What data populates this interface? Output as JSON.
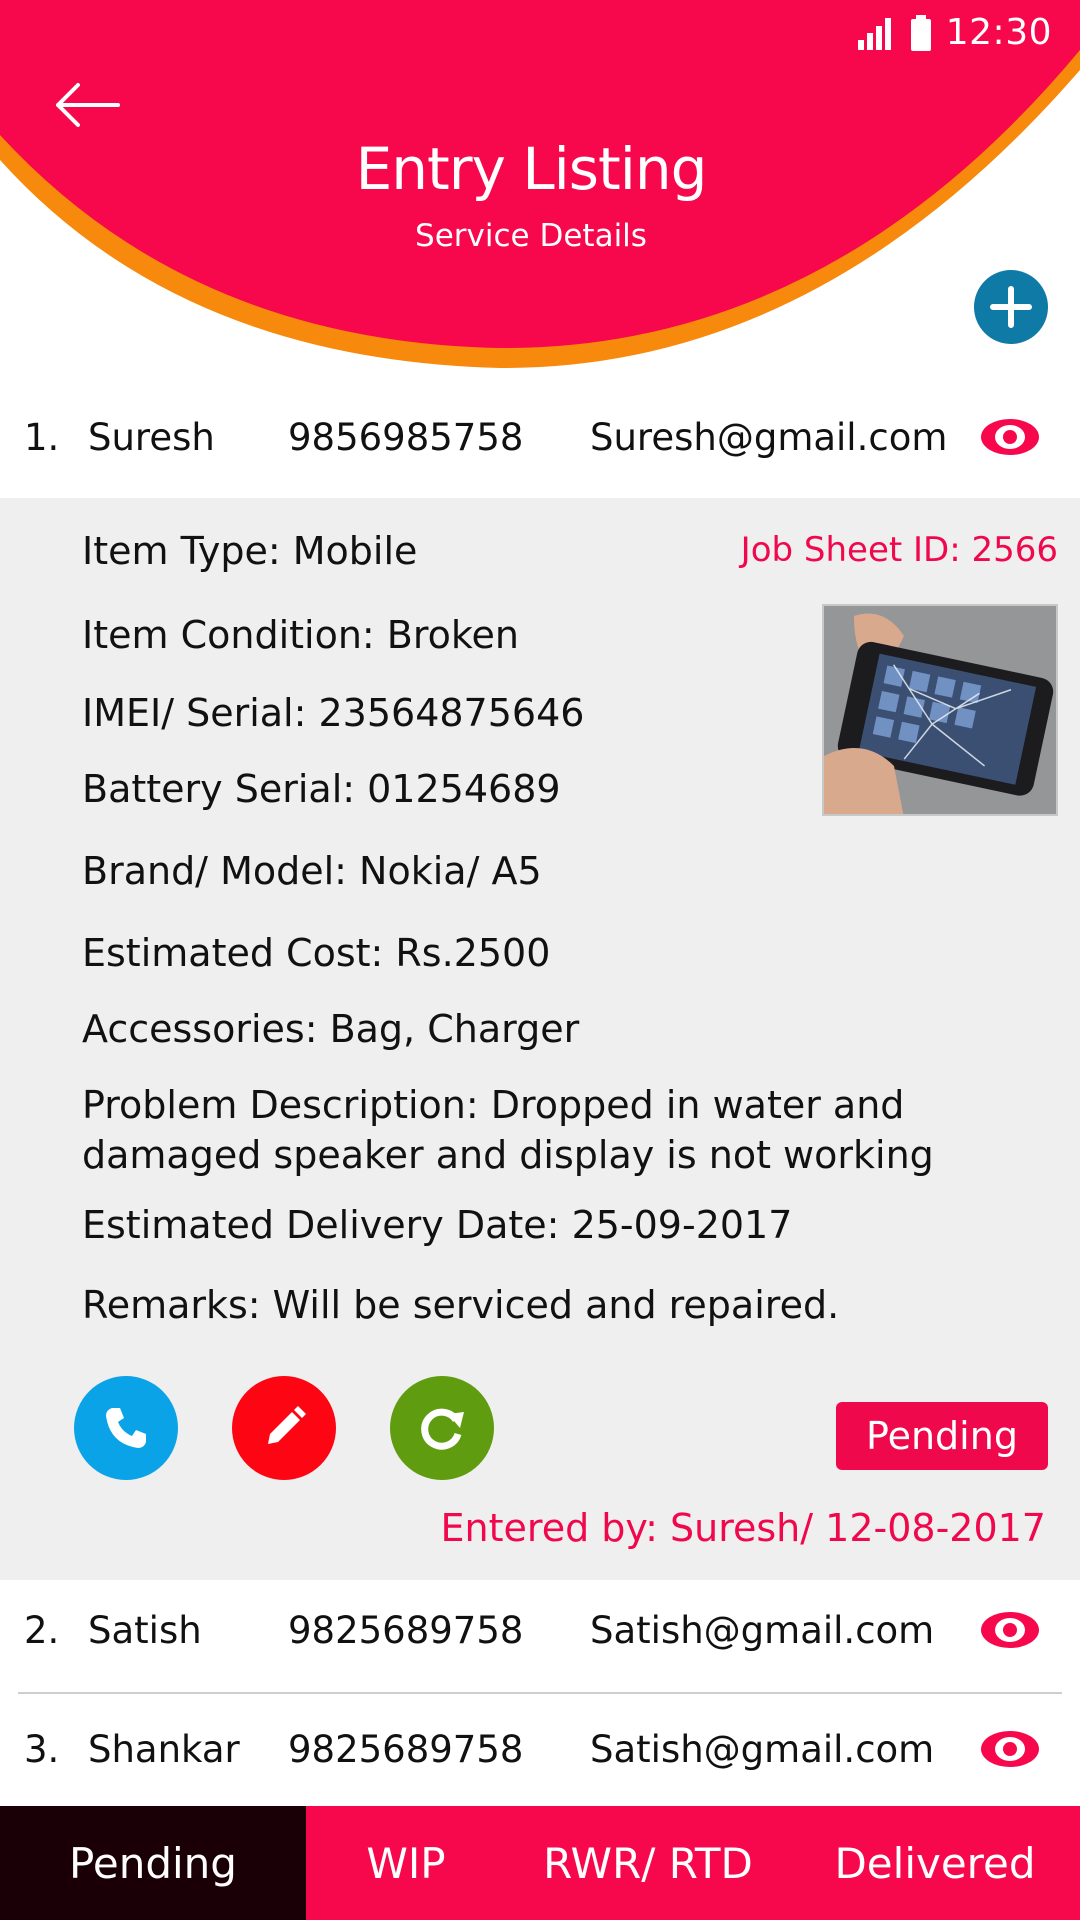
{
  "status_bar": {
    "time": "12:30"
  },
  "header": {
    "title": "Entry Listing",
    "subtitle": "Service Details",
    "primary_color": "#f7074b",
    "accent_color": "#f7890c"
  },
  "entries": [
    {
      "num": "1.",
      "name": "Suresh",
      "phone": "9856985758",
      "email": "Suresh@gmail.com"
    },
    {
      "num": "2.",
      "name": "Satish",
      "phone": "9825689758",
      "email": "Satish@gmail.com"
    },
    {
      "num": "3.",
      "name": "Shankar",
      "phone": "9825689758",
      "email": "Satish@gmail.com"
    }
  ],
  "detail": {
    "job_sheet_id": "Job Sheet ID: 2566",
    "item_type": "Item Type: Mobile",
    "item_condition": "Item Condition: Broken",
    "imei": "IMEI/ Serial: 23564875646",
    "battery_serial": "Battery Serial: 01254689",
    "brand_model": "Brand/ Model: Nokia/ A5",
    "estimated_cost": "Estimated Cost: Rs.2500",
    "accessories": "Accessories: Bag, Charger",
    "problem_line1": "Problem Description: Dropped in water and",
    "problem_line2": "damaged speaker and display is not working",
    "delivery_date": "Estimated Delivery Date: 25-09-2017",
    "remarks": "Remarks: Will be serviced and repaired.",
    "status": "Pending",
    "entered_by": "Entered by: Suresh/ 12-08-2017",
    "call_color": "#0ba3e8",
    "edit_color": "#fd0513",
    "refresh_color": "#5f9c10"
  },
  "tabs": [
    {
      "label": "Pending",
      "active": true
    },
    {
      "label": "WIP",
      "active": false
    },
    {
      "label": "RWR/ RTD",
      "active": false
    },
    {
      "label": "Delivered",
      "active": false
    }
  ]
}
